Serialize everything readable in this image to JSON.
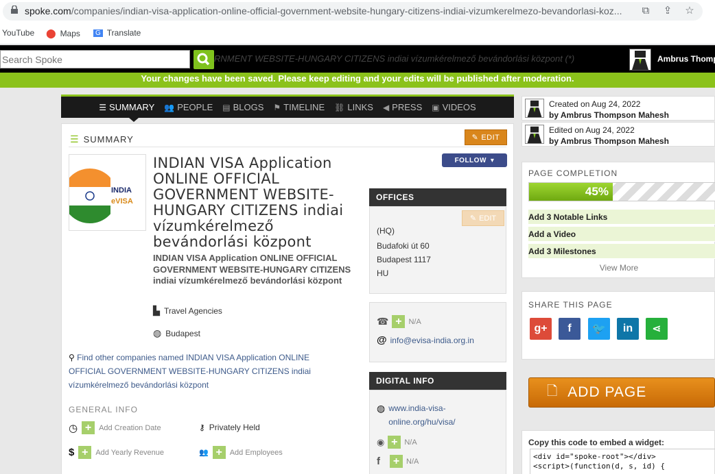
{
  "browser": {
    "url_domain": "spoke.com",
    "url_path": "/companies/indian-visa-application-online-official-government-website-hungary-citizens-indiai-vizumkerelmezo-bevandorlasi-koz...",
    "bookmarks": [
      "YouTube",
      "Maps",
      "Translate"
    ]
  },
  "header": {
    "search_placeholder": "Search Spoke",
    "ticker": "RNMENT WEBSITE-HUNGARY CITIZENS indiai vízumkérelmező bevándorlási központ (*)",
    "user_name": "Ambrus Thomp"
  },
  "notice": "Your changes have been saved. Please keep editing and your edits will be published after moderation.",
  "tabs": [
    {
      "label": "SUMMARY",
      "icon": "list-icon"
    },
    {
      "label": "PEOPLE",
      "icon": "people-icon"
    },
    {
      "label": "BLOGS",
      "icon": "rss-icon"
    },
    {
      "label": "TIMELINE",
      "icon": "flag-icon"
    },
    {
      "label": "LINKS",
      "icon": "link-icon"
    },
    {
      "label": "PRESS",
      "icon": "megaphone-icon"
    },
    {
      "label": "VIDEOS",
      "icon": "video-icon"
    }
  ],
  "summary": {
    "heading": "SUMMARY",
    "edit_label": "EDIT",
    "follow_label": "FOLLOW",
    "logo_line1": "INDIA",
    "logo_line2": "eVISA",
    "title": "INDIAN VISA Application ONLINE OFFICIAL GOVERNMENT WEBSITE-HUNGARY CITIZENS indiai vízumkérelmező bevándorlási központ",
    "subtitle": "INDIAN VISA Application ONLINE OFFICIAL GOVERNMENT WEBSITE-HUNGARY CITIZENS indiai vízumkérelmező bevándorlási központ",
    "industry": "Travel Agencies",
    "location": "Budapest",
    "find_other": "Find other companies named INDIAN VISA Application ONLINE OFFICIAL GOVERNMENT WEBSITE-HUNGARY CITIZENS indiai vízumkérelmező bevándorlási központ",
    "general_heading": "GENERAL INFO",
    "add_creation_date": "Add Creation Date",
    "privately_held": "Privately Held",
    "add_yearly_revenue": "Add Yearly Revenue",
    "add_employees": "Add Employees"
  },
  "offices": {
    "heading": "OFFICES",
    "edit_label": "EDIT",
    "hq": "(HQ)",
    "street": "Budafoki út 60",
    "city": "Budapest 1117",
    "country": "HU",
    "phone": "N/A",
    "email": "info@evisa-india.org.in"
  },
  "digital": {
    "heading": "DIGITAL INFO",
    "website": "www.india-visa-online.org/hu/visa/",
    "rss": "N/A",
    "facebook": "N/A"
  },
  "meta": {
    "created": "Created on Aug 24, 2022",
    "created_by": "by Ambrus Thompson Mahesh",
    "edited": "Edited on Aug 24, 2022",
    "edited_by": "by Ambrus Thompson Mahesh"
  },
  "completion": {
    "heading": "PAGE COMPLETION",
    "percent_label": "45%",
    "percent": 45,
    "todos": [
      "Add 3 Notable Links",
      "Add a Video",
      "Add 3 Milestones"
    ],
    "view_more": "View More"
  },
  "share": {
    "heading": "SHARE THIS PAGE",
    "colors": {
      "google": "#dd4b39",
      "facebook": "#3b5998",
      "twitter": "#1da1f2",
      "linkedin": "#0e76a8",
      "share": "#26b03b"
    }
  },
  "add_page": "ADD PAGE",
  "embed": {
    "heading": "Copy this code to embed a widget:",
    "code": "<div id=\"spoke-root\"></div>\n<script>(function(d, s, id) {"
  }
}
